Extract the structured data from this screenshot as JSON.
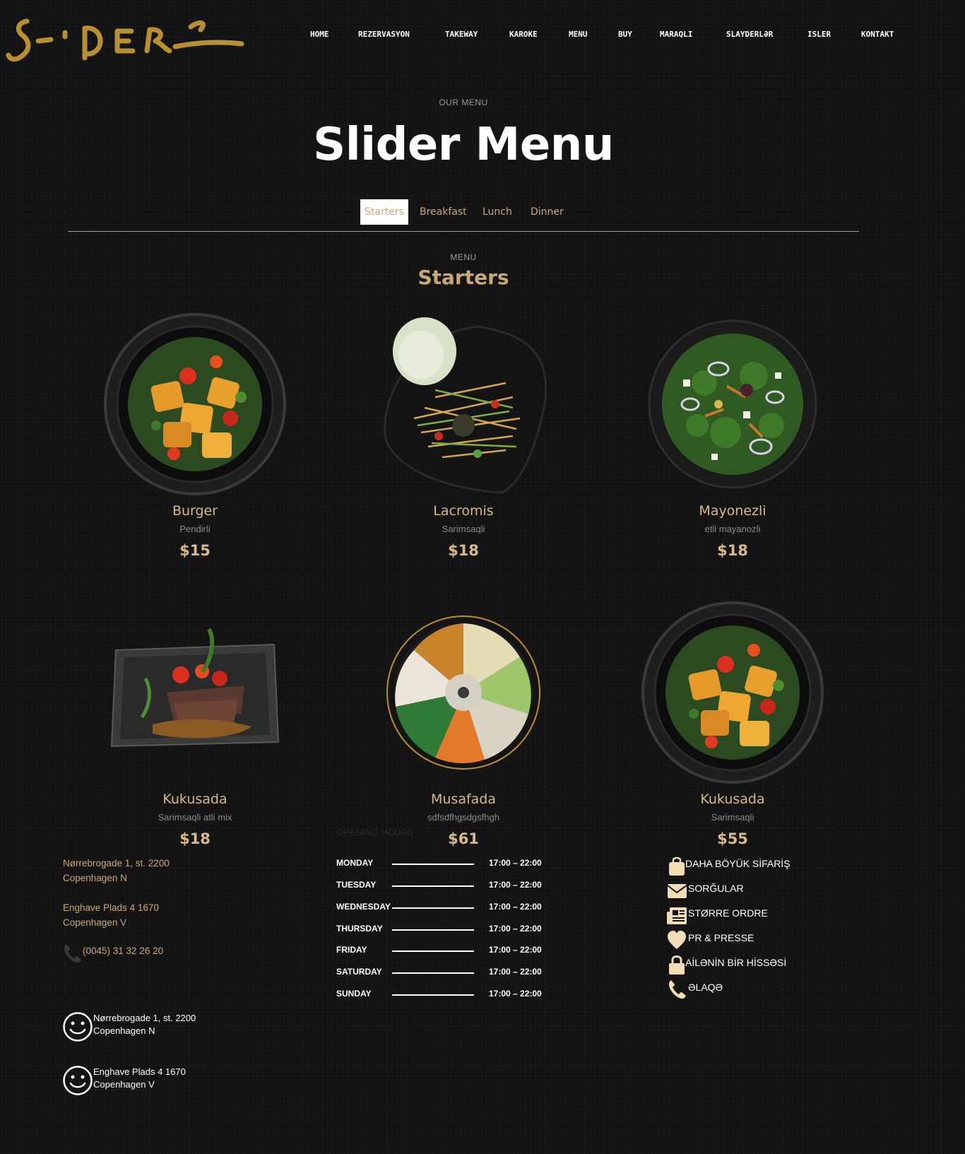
{
  "brand": {
    "logo_text": "Slider"
  },
  "nav": {
    "items": [
      {
        "label": "HOME"
      },
      {
        "label": "REZERVASYON"
      },
      {
        "label": "TAKEWAY"
      },
      {
        "label": "KAROKE"
      },
      {
        "label": "MENU"
      },
      {
        "label": "BUY"
      },
      {
        "label": "MARAQLI"
      },
      {
        "label": "SLAYDERLƏR"
      },
      {
        "label": "ISLER"
      },
      {
        "label": "KONTAKT"
      }
    ]
  },
  "hero": {
    "eyebrow": "OUR MENU",
    "title": "Slider Menu"
  },
  "tabs": [
    {
      "label": "Starters",
      "active": true
    },
    {
      "label": "Breakfast"
    },
    {
      "label": "Lunch"
    },
    {
      "label": "Dinner"
    }
  ],
  "section": {
    "eyebrow": "MENU",
    "title": "Starters"
  },
  "dishes": [
    {
      "name": "Burger",
      "desc": "Pendirli",
      "price": "$15",
      "image": "tofu-bowl"
    },
    {
      "name": "Lacromis",
      "desc": "Sarimsaqli",
      "price": "$18",
      "image": "papaya-salad"
    },
    {
      "name": "Mayonezli",
      "desc": "etli mayanozli",
      "price": "$18",
      "image": "green-salad"
    },
    {
      "name": "Kukusada",
      "desc": "Sarimsaqli atli mix",
      "price": "$18",
      "image": "steak-plate"
    },
    {
      "name": "Musafada",
      "desc": "sdfsdfhgsdgsfhgh",
      "price": "$61",
      "image": "poke-bowl"
    },
    {
      "name": "Kukusada",
      "desc": "Sarimsaqli",
      "price": "$55",
      "image": "tofu-bowl"
    }
  ],
  "footer": {
    "address1": {
      "line1": "Nørrebrogade 1, st. 2200",
      "line2": "Copenhagen N"
    },
    "address2": {
      "line1": "Enghave Plads 4 1670",
      "line2": "Copenhagen V"
    },
    "phone": "(0045) 31 32 26 20",
    "hours_heading": "OPENING HOURS",
    "hours": [
      {
        "day": "MONDAY",
        "time": "17:00 – 22:00"
      },
      {
        "day": "TUESDAY",
        "time": "17:00 – 22:00"
      },
      {
        "day": "WEDNESDAY",
        "time": "17:00 – 22:00"
      },
      {
        "day": "THURSDAY",
        "time": "17:00 – 22:00"
      },
      {
        "day": "FRIDAY",
        "time": "17:00 – 22:00"
      },
      {
        "day": "SATURDAY",
        "time": "17:00 – 22:00"
      },
      {
        "day": "SUNDAY",
        "time": "17:00 – 22:00"
      }
    ],
    "links": [
      {
        "label": "DAHA BÖYÜK SİFARİŞ",
        "icon": "shopping-bag-icon"
      },
      {
        "label": "SORĞULAR",
        "icon": "envelope-icon"
      },
      {
        "label": "STØRRE ORDRE",
        "icon": "newspaper-icon"
      },
      {
        "label": "PR & PRESSE",
        "icon": "heart-icon"
      },
      {
        "label": "AİLƏNİN BİR HİSSƏSİ",
        "icon": "lock-icon"
      },
      {
        "label": "ƏLAQƏ",
        "icon": "phone-icon"
      }
    ],
    "locations": [
      {
        "line1": "Nørrebrogade 1, st. 2200",
        "line2": "Copenhagen N",
        "icon": "smiley-icon"
      },
      {
        "line1": "Enghave Plads 4 1670",
        "line2": "Copenhagen V",
        "icon": "smiley-icon"
      }
    ]
  },
  "colors": {
    "accent": "#c9a876",
    "background": "#141414",
    "text_light": "#ffffff"
  }
}
